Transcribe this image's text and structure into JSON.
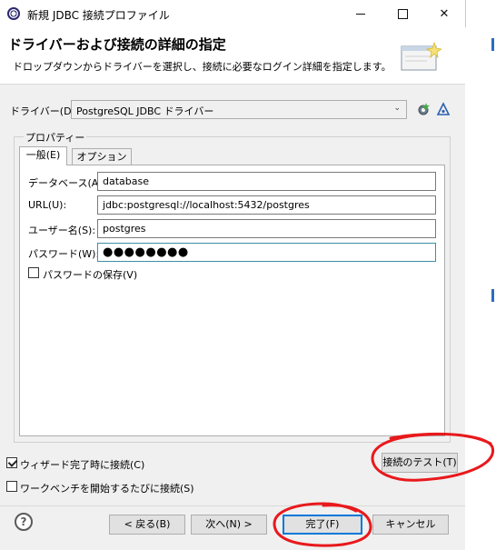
{
  "window": {
    "title": "新規 JDBC 接続プロファイル",
    "minimize": "—",
    "maximize": "□",
    "close": "✕"
  },
  "header": {
    "title": "ドライバーおよび接続の詳細の指定",
    "description": "ドロップダウンからドライバーを選択し、接続に必要なログイン詳細を指定します。"
  },
  "driver": {
    "label": "ドライバー(D):",
    "selected": "PostgreSQL JDBC ドライバー",
    "new_driver_icon": "new-driver-icon",
    "edit_driver_icon": "edit-driver-icon"
  },
  "properties": {
    "group_label": "プロパティー",
    "tabs": [
      {
        "label": "一般(E)",
        "active": true
      },
      {
        "label": "オプション(O)",
        "active": false
      }
    ],
    "fields": {
      "database": {
        "label": "データベース(A):",
        "value": "database"
      },
      "url": {
        "label": "URL(U):",
        "value": "jdbc:postgresql://localhost:5432/postgres"
      },
      "username": {
        "label": "ユーザー名(S):",
        "value": "postgres"
      },
      "password": {
        "label": "パスワード(W):",
        "value": "●●●●●●●●"
      }
    },
    "save_password": {
      "label": "パスワードの保存(V)",
      "checked": false
    }
  },
  "options": {
    "connect_on_finish": {
      "label": "ウィザード完了時に接続(C)",
      "checked": true
    },
    "connect_on_startup": {
      "label": "ワークベンチを開始するたびに接続(S)",
      "checked": false
    }
  },
  "buttons": {
    "test_connection": "接続のテスト(T)",
    "back": "< 戻る(B)",
    "next": "次へ(N) >",
    "finish": "完了(F)",
    "cancel": "キャンセル",
    "help": "?"
  },
  "colors": {
    "annotation": "#e8191c",
    "focus_border": "#3c8fa3",
    "default_button": "#0078d7"
  }
}
